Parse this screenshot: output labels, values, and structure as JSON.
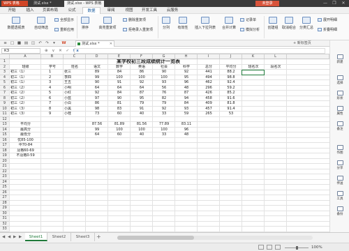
{
  "titlebar": {
    "app": "WPS 表格",
    "tabs": [
      "测试.xlsx *",
      "测试.xlsx - WPS 表格"
    ],
    "login": "未登录",
    "win": [
      "—",
      "❐",
      "✕"
    ]
  },
  "menus": [
    "开始",
    "插入",
    "页面布局",
    "公式",
    "数据",
    "审阅",
    "视图",
    "开发工具",
    "云服务"
  ],
  "active_menu": "数据",
  "ribbon": {
    "pivot": "数据透视表",
    "autofilter": "自动筛选",
    "all_show": "全部显示",
    "reapply": "重新应用",
    "sort_label": "排序",
    "dup_label": "高亮重复项",
    "del_dup": "删除重复项",
    "reject_dup": "拒绝录入重复项",
    "split": "分列",
    "validity": "有效性",
    "insert_dropdown": "插入下拉列表",
    "consolidate": "合并计算",
    "record": "记录单",
    "simulate": "模拟分析",
    "create_group": "创建组",
    "ungroup": "取消组合",
    "subtotal": "分类汇总",
    "expand": "展开明细",
    "collapse": "折叠明细"
  },
  "filetab": {
    "name": "测试.xlsx *",
    "hint": "+ 新标签页"
  },
  "namebox": "K3",
  "fx_icons": [
    "⊕",
    "∨",
    "✕",
    "✓",
    "fx"
  ],
  "columns": [
    "A",
    "B",
    "C",
    "D",
    "E",
    "F",
    "G",
    "H",
    "I",
    "J",
    "K",
    "L"
  ],
  "rows": [
    "1",
    "2",
    "3",
    "4",
    "5",
    "6",
    "7",
    "8",
    "9",
    "10",
    "11",
    "12",
    "13",
    "14",
    "15",
    "16",
    "17",
    "18",
    "19",
    "20",
    "21",
    "22",
    "23",
    "24",
    "25",
    "26",
    "27",
    "28",
    "29",
    "30",
    "31",
    "32",
    "33"
  ],
  "sheet_title": "某学校初三段成绩统计一览表",
  "headers": [
    "班级",
    "学号",
    "姓名",
    "语文",
    "数学",
    "英语",
    "社会",
    "科学",
    "总分",
    "平均分",
    "班名次",
    "段名次"
  ],
  "students": [
    [
      "初三（1）",
      "1",
      "张三",
      "89",
      "84",
      "86",
      "90",
      "92",
      "441",
      "88.2"
    ],
    [
      "初三（1）",
      "2",
      "李四",
      "99",
      "100",
      "100",
      "100",
      "95",
      "494",
      "98.8"
    ],
    [
      "初三（1）",
      "3",
      "王五",
      "90",
      "91",
      "92",
      "93",
      "96",
      "462",
      "92.4"
    ],
    [
      "初三（2）",
      "4",
      "小明",
      "64",
      "64",
      "64",
      "56",
      "48",
      "296",
      "59.2"
    ],
    [
      "初三（2）",
      "5",
      "小红",
      "92",
      "84",
      "87",
      "76",
      "87",
      "426",
      "85.2"
    ],
    [
      "初三（2）",
      "6",
      "小蓝",
      "97",
      "90",
      "95",
      "82",
      "94",
      "458",
      "91.6"
    ],
    [
      "初三（2）",
      "7",
      "小白",
      "86",
      "81",
      "79",
      "79",
      "84",
      "409",
      "81.8"
    ],
    [
      "初三（3）",
      "8",
      "小黑",
      "98",
      "83",
      "91",
      "92",
      "93",
      "457",
      "91.4"
    ],
    [
      "初三（3）",
      "9",
      "小桂",
      "73",
      "60",
      "40",
      "33",
      "59",
      "265",
      "53"
    ]
  ],
  "stats": [
    {
      "label": "平均分",
      "values": [
        "87.56",
        "81.89",
        "81.56",
        "77.89",
        "83.11"
      ]
    },
    {
      "label": "最高分",
      "values": [
        "99",
        "100",
        "100",
        "100",
        "96"
      ]
    },
    {
      "label": "最低分",
      "values": [
        "64",
        "60",
        "40",
        "33",
        "48"
      ]
    },
    {
      "label": "优85-100",
      "values": []
    },
    {
      "label": "中70-84",
      "values": []
    },
    {
      "label": "及格60-69",
      "values": []
    },
    {
      "label": "不及格0-59",
      "values": []
    }
  ],
  "right_panel": [
    "新建",
    "选择",
    "形状",
    "属性",
    "备注",
    "作图",
    "分享",
    "传送",
    "工具",
    "备份"
  ],
  "sheets": [
    "Sheet1",
    "Sheet2",
    "Sheet3"
  ],
  "active_sheet": "Sheet1",
  "sheet_nav": [
    "◀",
    "◀",
    "▶",
    "▶"
  ],
  "zoom": "100%",
  "colors": {
    "accent": "#1f7a3a",
    "brand": "#d04526",
    "title_bar": "#3a3a3a"
  }
}
